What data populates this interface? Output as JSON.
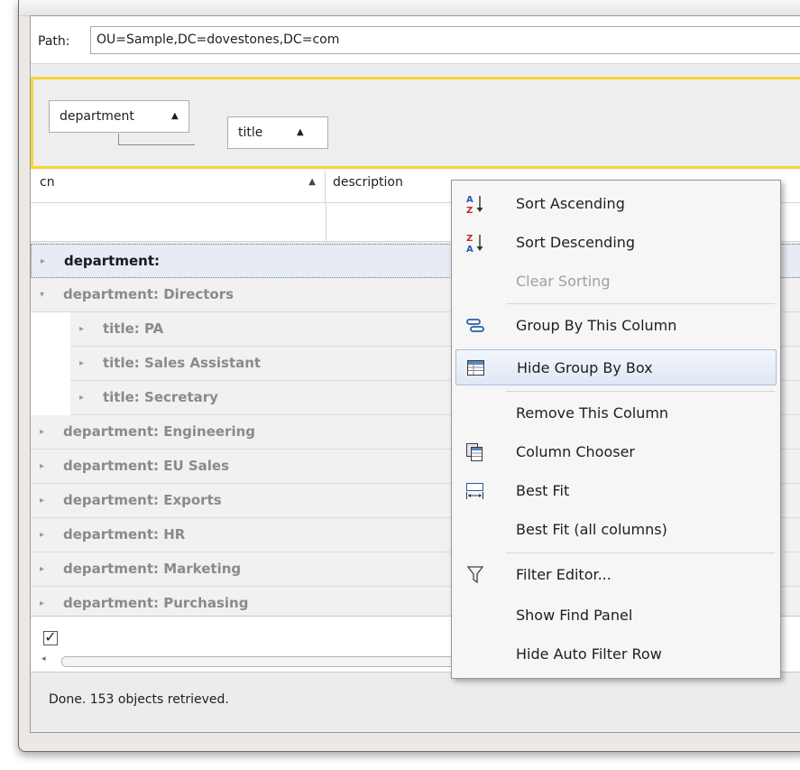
{
  "path": {
    "label": "Path:",
    "value": "OU=Sample,DC=dovestones,DC=com"
  },
  "group_panel": {
    "chips": [
      {
        "label": "department",
        "sort": "▲"
      },
      {
        "label": "title",
        "sort": "▲"
      }
    ]
  },
  "columns": [
    {
      "label": "cn",
      "sort": "▲"
    },
    {
      "label": "description"
    }
  ],
  "rows": [
    {
      "text": "department:",
      "expand": "▸"
    },
    {
      "text": "department: Directors",
      "expand": "▾"
    },
    {
      "text": "title: PA",
      "expand": "▸"
    },
    {
      "text": "title: Sales Assistant",
      "expand": "▸"
    },
    {
      "text": "title: Secretary",
      "expand": "▸"
    },
    {
      "text": "department: Engineering",
      "expand": "▸"
    },
    {
      "text": "department: EU Sales",
      "expand": "▸"
    },
    {
      "text": "department: Exports",
      "expand": "▸"
    },
    {
      "text": "department: HR",
      "expand": "▸"
    },
    {
      "text": "department: Marketing",
      "expand": "▸"
    },
    {
      "text": "department: Purchasing",
      "expand": "▸"
    }
  ],
  "bottom": {
    "checkbox": "✓",
    "scroll_left": "◂"
  },
  "status": {
    "text": "Done. 153 objects retrieved."
  },
  "menu": {
    "items": [
      {
        "label": "Sort Ascending",
        "icon": "sort-ascending-icon"
      },
      {
        "label": "Sort Descending",
        "icon": "sort-descending-icon"
      },
      {
        "label": "Clear Sorting",
        "disabled": true
      },
      {
        "label": "Group By This Column",
        "icon": "group-by-icon"
      },
      {
        "label": "Hide Group By Box",
        "icon": "group-box-icon",
        "highlighted": true
      },
      {
        "label": "Remove This Column"
      },
      {
        "label": "Column Chooser",
        "icon": "column-chooser-icon"
      },
      {
        "label": "Best Fit",
        "icon": "best-fit-icon"
      },
      {
        "label": "Best Fit (all columns)"
      },
      {
        "label": "Filter Editor...",
        "icon": "filter-icon"
      },
      {
        "label": "Show Find Panel"
      },
      {
        "label": "Hide Auto Filter Row"
      }
    ]
  }
}
